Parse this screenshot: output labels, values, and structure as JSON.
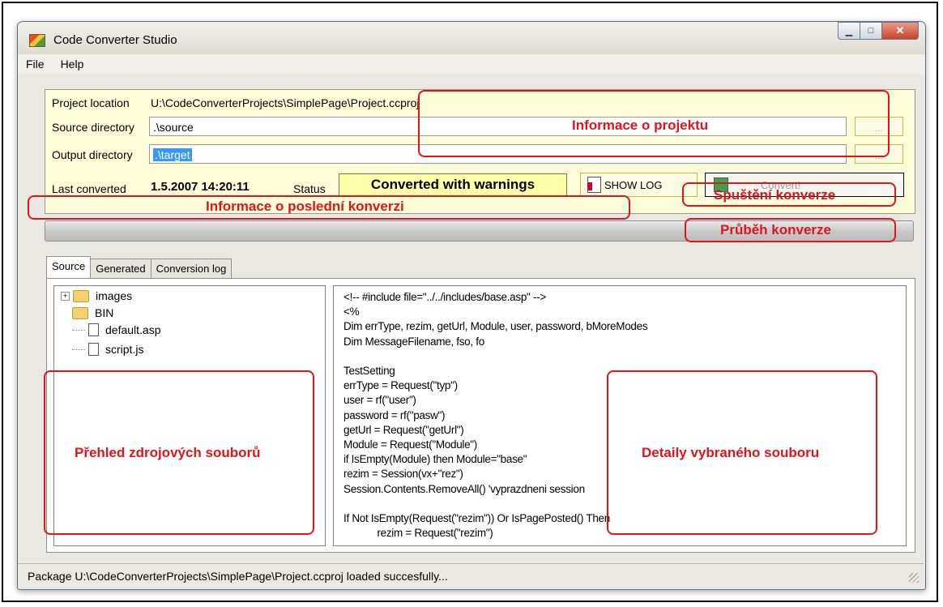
{
  "window": {
    "title": "Code Converter Studio"
  },
  "menu": [
    "File",
    "Help"
  ],
  "project": {
    "location_label": "Project location",
    "location_value": "U:\\CodeConverterProjects\\SimplePage\\Project.ccproj",
    "source_label": "Source directory",
    "source_value": ".\\source",
    "output_label": "Output directory",
    "output_value": ".\\target",
    "browse_label": "...",
    "last_converted_label": "Last converted",
    "last_converted_value": "1.5.2007 14:20:11",
    "status_label": "Status",
    "status_value": "Converted with warnings",
    "show_log_label": "SHOW LOG",
    "convert_label": "Convert!"
  },
  "tabs": [
    "Source",
    "Generated",
    "Conversion log"
  ],
  "tree": [
    {
      "name": "images",
      "type": "folder",
      "expandable": true
    },
    {
      "name": "BIN",
      "type": "folder",
      "expandable": false
    },
    {
      "name": "default.asp",
      "type": "file",
      "expandable": false
    },
    {
      "name": "script.js",
      "type": "file",
      "expandable": false
    }
  ],
  "code_lines": [
    "<!-- #include file=\"../../includes/base.asp\" -->",
    "<%",
    "Dim errType, rezim, getUrl, Module, user, password, bMoreModes",
    "Dim MessageFilename, fso, fo",
    "",
    "TestSetting",
    "errType = Request(\"typ\")",
    "user = rf(\"user\")",
    "password = rf(\"pasw\")",
    "getUrl = Request(\"getUrl\")",
    "Module = Request(\"Module\")",
    "if IsEmpty(Module) then Module=\"base\"",
    "rezim = Session(vx+\"rez\")",
    "Session.Contents.RemoveAll() 'vyprazdneni session",
    "",
    "If Not IsEmpty(Request(\"rezim\")) Or IsPagePosted() Then",
    "            rezim = Request(\"rezim\")"
  ],
  "statusbar": {
    "text": "Package U:\\CodeConverterProjects\\SimplePage\\Project.ccproj loaded succesfully..."
  },
  "annotations": {
    "project_info": "Informace o projektu",
    "last_conversion": "Informace o poslední konverzi",
    "start_conversion": "Spuštění konverze",
    "progress": "Průběh konverze",
    "source_overview": "Přehled zdrojových souborů",
    "file_details": "Detaily vybraného souboru"
  },
  "colors": {
    "annotation": "#e0141b",
    "info_panel": "#fdfdda",
    "status_box": "#ffffaa",
    "selection": "#3399ff"
  }
}
